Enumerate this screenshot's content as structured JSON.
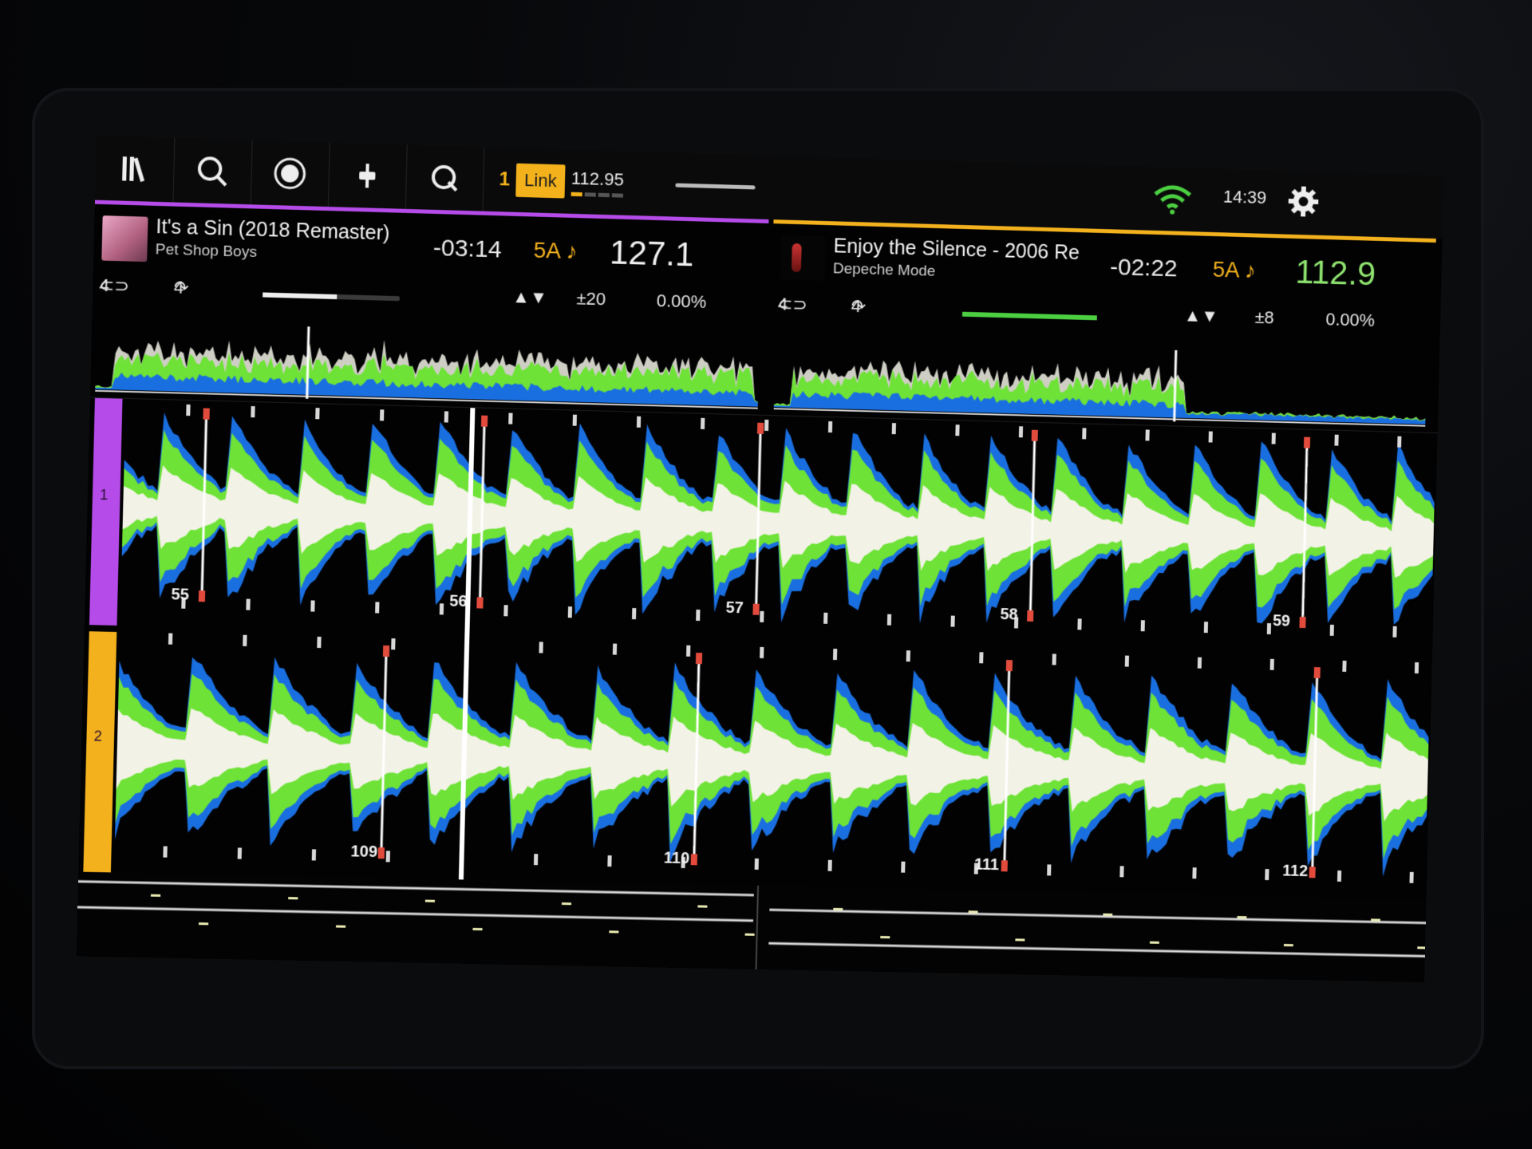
{
  "topbar": {
    "icons": [
      "library-icon",
      "search-icon",
      "record-icon",
      "mixer-icon",
      "quantize-icon"
    ],
    "link_number": "1",
    "link_label": "Link",
    "link_bpm": "112.95",
    "time": "14:39",
    "accent_color": "#f3b21c"
  },
  "deck_a": {
    "title": "It's a Sin (2018 Remaster)",
    "artist": "Pet Shop Boys",
    "remaining": "-03:14",
    "key": "5A ♪",
    "bpm": "127.1",
    "loop": "4",
    "jump": "4",
    "pitch_range": "±20",
    "pitch": "0.00%",
    "color": "#b54be8",
    "deck_number": "1"
  },
  "deck_b": {
    "title": "Enjoy the Silence - 2006 Re",
    "artist": "Depeche Mode",
    "remaining": "-02:22",
    "key": "5A ♪",
    "bpm": "112.9",
    "loop": "4",
    "jump": "4",
    "pitch_range": "±8",
    "pitch": "0.00%",
    "color": "#f2b11d",
    "deck_number": "2"
  },
  "beat_markers_a": [
    "55",
    "56",
    "57",
    "58",
    "59"
  ],
  "beat_markers_b": [
    "109",
    "110",
    "111",
    "112"
  ],
  "waveform_colors": {
    "low": "#1a6fe0",
    "mid": "#6ee236",
    "high": "#f2f2e6"
  }
}
